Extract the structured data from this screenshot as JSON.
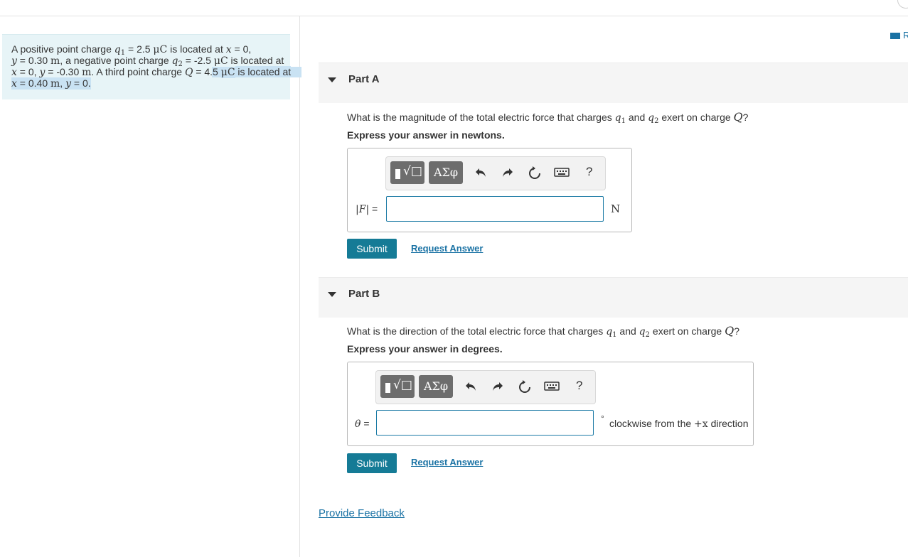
{
  "problem": {
    "line1_a": "A positive point charge ",
    "q1": "q",
    "q1_sub": "1",
    "line1_b": " = 2.5 ",
    "unit_uC": "μC",
    "line1_c": " is located at ",
    "x": "x",
    "line1_d": " = 0,",
    "y": "y",
    "line2_a": " = 0.30 ",
    "unit_m": "m",
    "line2_b": ", a negative point charge ",
    "q2": "q",
    "q2_sub": "2",
    "line2_c": " = -2.5 ",
    "line2_d": " is located at",
    "line3_a": " = 0, ",
    "line3_b": " = -0.30 ",
    "line3_c": ". A third point charge ",
    "Q": "Q",
    "line3_d": " = 4.5 ",
    "line3_e": " is located at",
    "line4_a": " = 0.40 ",
    "line4_b": ", ",
    "line4_c": " = 0."
  },
  "reference_link": "R",
  "partA": {
    "title": "Part A",
    "question_a": "What is the magnitude of the total electric force that charges ",
    "q1": "q",
    "q1_sub": "1",
    "question_b": " and ",
    "q2": "q",
    "q2_sub": "2",
    "question_c": " exert on charge ",
    "Q": "Q",
    "question_d": "?",
    "instruction": "Express your answer in newtons.",
    "toolbar": {
      "templates_label": "√□",
      "symbols_label": "ΑΣφ",
      "help_label": "?"
    },
    "label_F": "F",
    "label_eq": " =",
    "input_value": "",
    "unit": "N",
    "submit": "Submit",
    "request": "Request Answer"
  },
  "partB": {
    "title": "Part B",
    "question_a": "What is the direction of the total electric force that charges ",
    "q1": "q",
    "q1_sub": "1",
    "question_b": " and ",
    "q2": "q",
    "q2_sub": "2",
    "question_c": " exert on charge ",
    "Q": "Q",
    "question_d": "?",
    "instruction": "Express your answer in degrees.",
    "toolbar": {
      "templates_label": "√□",
      "symbols_label": "ΑΣφ",
      "help_label": "?"
    },
    "label_theta": "θ",
    "label_eq": " =",
    "input_value": "",
    "degree_symbol": "°",
    "suffix_a": "clockwise from the ",
    "suffix_plusx": "+x",
    "suffix_b": " direction",
    "submit": "Submit",
    "request": "Request Answer"
  },
  "feedback": "Provide Feedback",
  "colors": {
    "accent": "#157b96",
    "link": "#1a72a4",
    "problem_bg": "#e7f4f7",
    "highlight": "#c9e2f3"
  }
}
